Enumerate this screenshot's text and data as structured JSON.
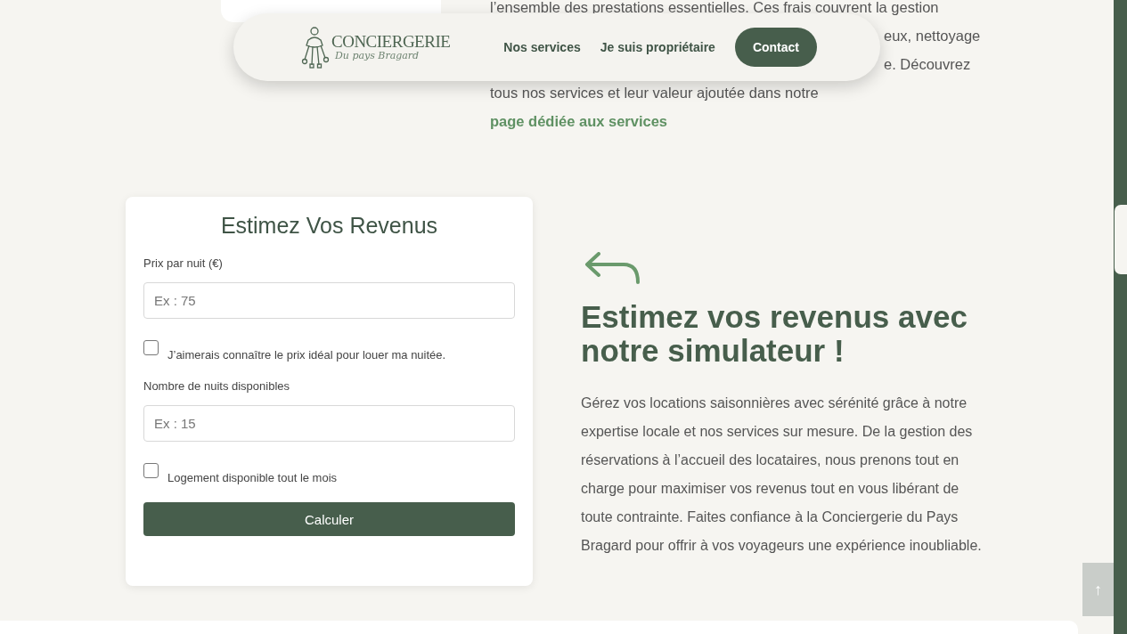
{
  "background_text": {
    "lines": [
      "l’ensemble des prestations essentielles. Ces frais couvrent la gestion",
      "eux, nettoyage",
      "e. Découvrez"
    ],
    "last_line": "tous nos services et leur valeur ajoutée dans notre",
    "link": "page dédiée aux services"
  },
  "nav": {
    "logo": {
      "title": "CONCIERGERIE",
      "subtitle": "Du pays Bragard"
    },
    "links": [
      {
        "label": "Nos services",
        "kind": "link"
      },
      {
        "label": "Je suis propriétaire",
        "kind": "link"
      },
      {
        "label": "Contact",
        "kind": "button"
      }
    ]
  },
  "form": {
    "title": "Estimez Vos Revenus",
    "fields": [
      {
        "kind": "input",
        "label": "Prix par nuit (€)",
        "placeholder": "Ex : 75"
      },
      {
        "kind": "checkbox",
        "label": "J’aimerais connaître le prix idéal pour louer ma nuitée.",
        "checked": false
      },
      {
        "kind": "input",
        "label": "Nombre de nuits disponibles",
        "placeholder": "Ex : 15"
      },
      {
        "kind": "checkbox",
        "label": "Logement disponible tout le mois",
        "checked": false
      }
    ],
    "button": "Calculer"
  },
  "intro": {
    "heading": "Estimez vos revenus avec notre simulateur !",
    "body": "Gérez vos locations saisonnières avec sérénité grâce à notre expertise locale et nos services sur mesure. De la gestion des réservations à l’accueil des locataires, nous prenons tout en charge pour maximiser vos revenus tout en vous libérant de toute contrainte. Faites confiance à la Conciergerie du Pays Bragard pour offrir à vos voyageurs une expérience inoubliable."
  },
  "back_to_top": "↑"
}
